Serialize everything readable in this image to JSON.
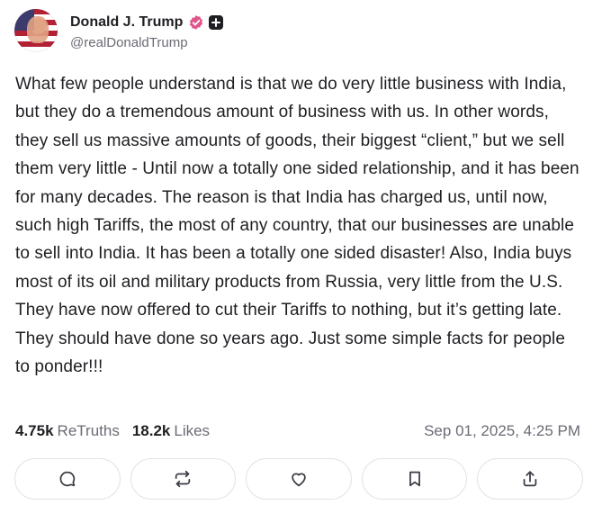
{
  "user": {
    "display_name": "Donald J. Trump",
    "handle": "@realDonaldTrump",
    "verified_badge_color": "#e0558a"
  },
  "post": {
    "text": "What few people understand is that we do very little business with India, but they do a tremendous amount of business with us. In other words, they sell us massive amounts of goods, their biggest “client,” but we sell them very little - Until now a totally one sided relationship, and it has been for many decades. The reason is that India has charged us, until now, such high Tariffs, the most of any country, that our businesses are unable to sell into India. It has been a totally one sided disaster! Also, India buys most of its oil and military products from Russia, very little from the U.S. They have now offered to cut their Tariffs to nothing, but it’s getting late. They should have done so years ago. Just some simple facts for people to ponder!!!"
  },
  "stats": {
    "retruths_count": "4.75k",
    "retruths_label": "ReTruths",
    "likes_count": "18.2k",
    "likes_label": "Likes",
    "timestamp": "Sep 01, 2025, 4:25 PM"
  },
  "actions": [
    {
      "icon": "reply-icon"
    },
    {
      "icon": "retruth-icon"
    },
    {
      "icon": "like-icon"
    },
    {
      "icon": "bookmark-icon"
    },
    {
      "icon": "share-icon"
    }
  ]
}
